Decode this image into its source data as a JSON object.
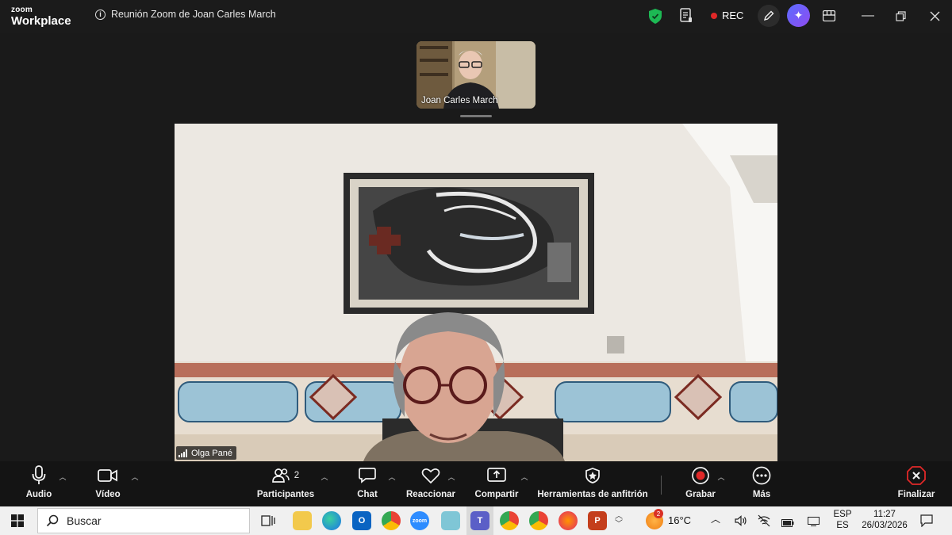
{
  "app": {
    "brand_top": "zoom",
    "brand_bottom": "Workplace",
    "meeting_title": "Reunión Zoom de Joan Carles March",
    "rec_label": "REC"
  },
  "participants": {
    "thumbnail_name": "Joan Carles March",
    "speaker_name": "Olga Pané"
  },
  "toolbar": {
    "audio": "Audio",
    "video": "Vídeo",
    "participants": "Participantes",
    "participants_count": "2",
    "chat": "Chat",
    "react": "Reaccionar",
    "share": "Compartir",
    "host_tools": "Herramientas de anfitrión",
    "record": "Grabar",
    "more": "Más",
    "end": "Finalizar"
  },
  "taskbar": {
    "search_placeholder": "Buscar",
    "weather_temp": "16°C",
    "weather_badge": "2",
    "lang_top": "ESP",
    "lang_bottom": "ES",
    "time": "11:27",
    "date": "26/03/2026",
    "zoom_icon_label": "zoom"
  },
  "colors": {
    "record_red": "#e02828",
    "shield_green": "#1db954",
    "accent_ai": "#6b5cff"
  }
}
